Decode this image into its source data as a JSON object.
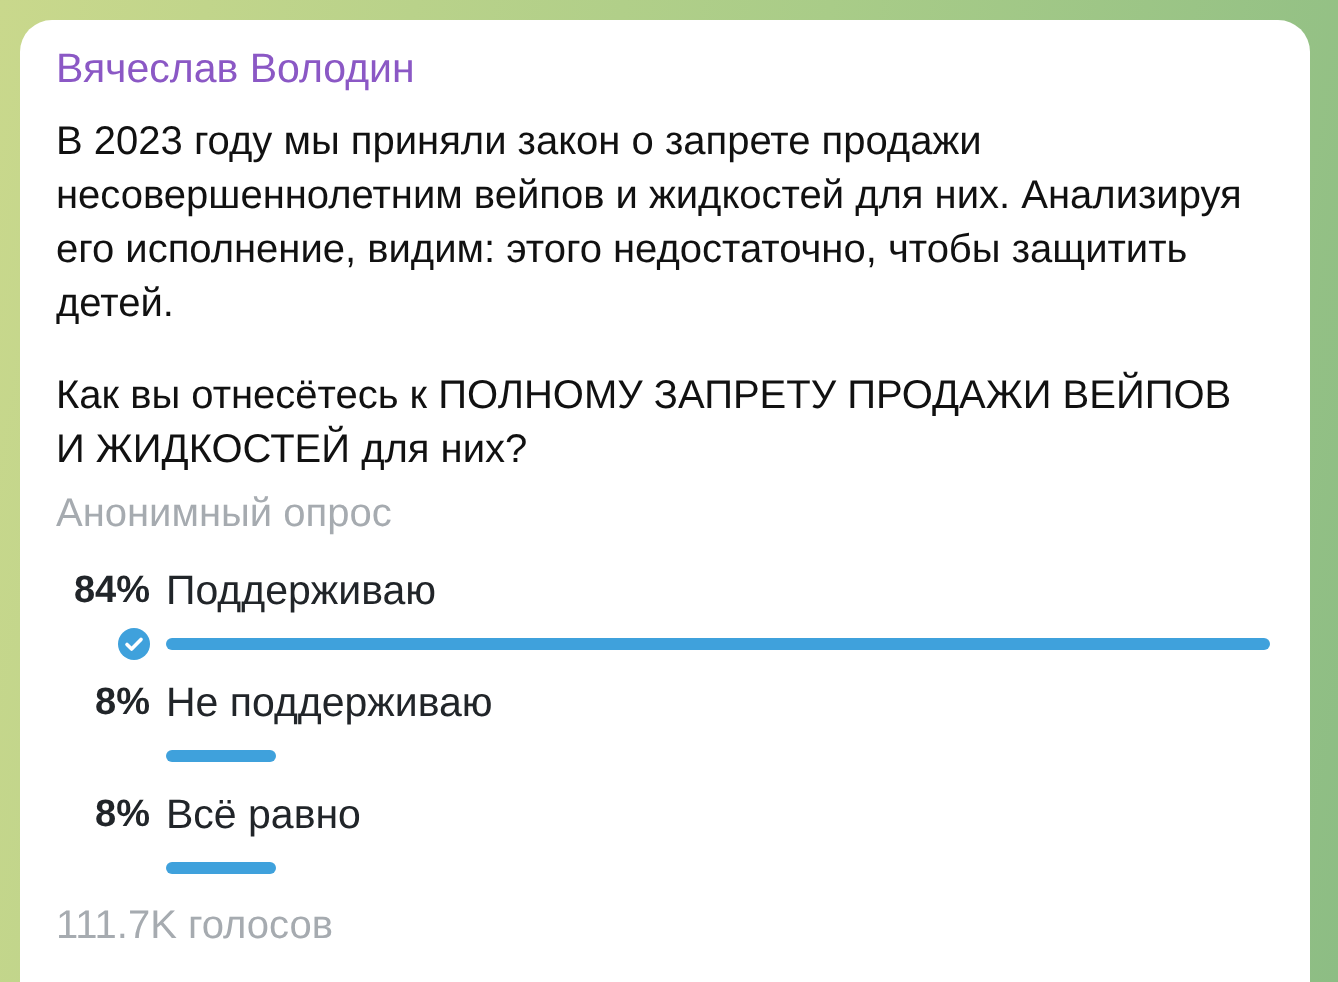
{
  "message": {
    "author": "Вячеслав Володин",
    "paragraphs": [
      "В 2023 году мы приняли закон о запрете продажи несовершеннолетним вейпов и жидкостей для них. Анализируя его исполнение, видим: этого недостаточно, чтобы защитить детей.",
      "Как вы отнесётесь к ПОЛНОМУ ЗАПРЕТУ ПРОДАЖИ ВЕЙПОВ И ЖИДКОСТЕЙ для них?"
    ],
    "poll": {
      "type": "Анонимный опрос",
      "options": [
        {
          "percent": "84%",
          "label": "Поддерживаю",
          "selected": true
        },
        {
          "percent": "8%",
          "label": "Не поддерживаю",
          "level": 0.1,
          "selected": false
        },
        {
          "percent": "8%",
          "label": "Всё равно",
          "level": 0.1,
          "selected": false
        }
      ],
      "votes": "111.7K голосов"
    }
  }
}
